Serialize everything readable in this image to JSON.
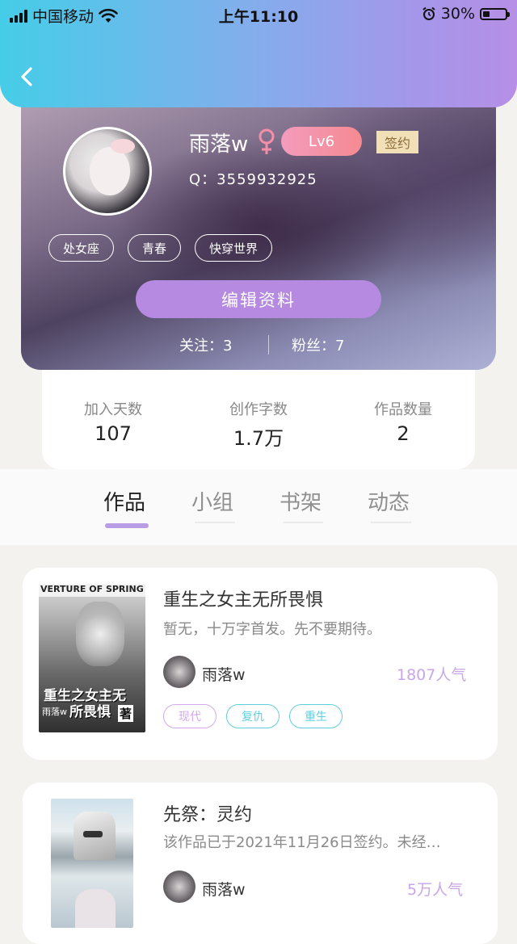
{
  "status_bar": {
    "carrier": "中国移动",
    "time": "上午11:10",
    "battery": "30%",
    "battery_level": 0.3
  },
  "profile": {
    "name": "雨落w",
    "level": "Lv6",
    "sign_badge": "签约",
    "qq": "Q：3559932925",
    "tags": [
      "处女座",
      "青春",
      "快穿世界"
    ],
    "edit_button": "编辑资料",
    "follow": "关注：3",
    "fans": "粉丝：7"
  },
  "stats": [
    {
      "label": "加入天数",
      "value": "107"
    },
    {
      "label": "创作字数",
      "value": "1.7万"
    },
    {
      "label": "作品数量",
      "value": "2"
    }
  ],
  "tabs": [
    "作品",
    "小组",
    "书架",
    "动态"
  ],
  "active_tab": "作品",
  "books": [
    {
      "title": "重生之女主无所畏惧",
      "desc": "暂无，十万字首发。先不要期待。",
      "author": "雨落w",
      "popularity": "1807人气",
      "tags": [
        {
          "label": "现代",
          "color": "#d3a8ec"
        },
        {
          "label": "复仇",
          "color": "#5fcfe0"
        },
        {
          "label": "重生",
          "color": "#5fcfe0"
        }
      ],
      "cover_text": [
        "VERTURE OF SPRING",
        "重生之女主无",
        "所畏惧",
        "雨落w",
        "著"
      ]
    },
    {
      "title": "先祭：灵约",
      "desc": "该作品已于2021年11月26日签约。未经…",
      "author": "雨落w",
      "popularity": "5万人气",
      "tags": [],
      "cover_text": []
    }
  ],
  "colors": {
    "accent_purple": "#b58ae0",
    "header_gradient_start": "#45cde8",
    "header_gradient_end": "#b68fe6",
    "lv_badge": "#f58a91",
    "sign_badge_bg": "#f1dfb7",
    "popularity": "#c9a6e7"
  }
}
